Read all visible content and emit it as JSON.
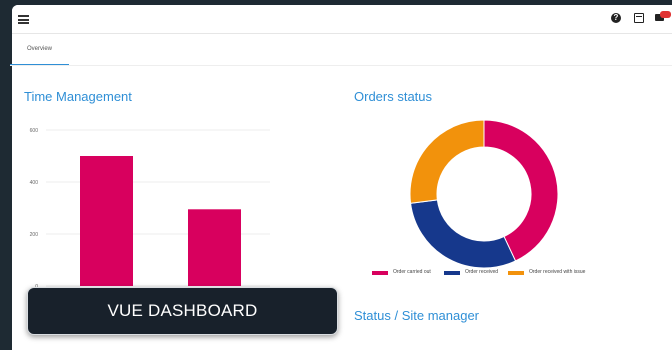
{
  "tabs": [
    {
      "label": "Overview"
    }
  ],
  "cards": {
    "time_management": {
      "title": "Time Management"
    },
    "orders_status": {
      "title": "Orders status"
    },
    "status_site_manager": {
      "title": "Status / Site manager"
    }
  },
  "topbar": {
    "icons": [
      "menu-icon",
      "help-icon",
      "calendar-icon",
      "chat-icon",
      "avatar"
    ],
    "badge": ""
  },
  "overlay": {
    "label": "VUE DASHBOARD"
  },
  "colors": {
    "accent": "#2f8fd6",
    "pink": "#d8005e",
    "navy": "#16388c",
    "orange": "#f2920c"
  },
  "chart_data": [
    {
      "type": "bar",
      "title": "Time Management",
      "categories": [
        "",
        ""
      ],
      "values": [
        500,
        295
      ],
      "ylim": [
        0,
        600
      ],
      "yticks": [
        "600",
        "400",
        "200",
        "0"
      ],
      "grid": true,
      "color": "#d8005e"
    },
    {
      "type": "pie",
      "title": "Orders status",
      "donut": true,
      "series": [
        {
          "name": "Order carried out",
          "value": 43,
          "color": "#d8005e"
        },
        {
          "name": "Order received",
          "value": 30,
          "color": "#16388c"
        },
        {
          "name": "Order received with issue",
          "value": 27,
          "color": "#f2920c"
        }
      ],
      "legend": "bottom"
    }
  ]
}
